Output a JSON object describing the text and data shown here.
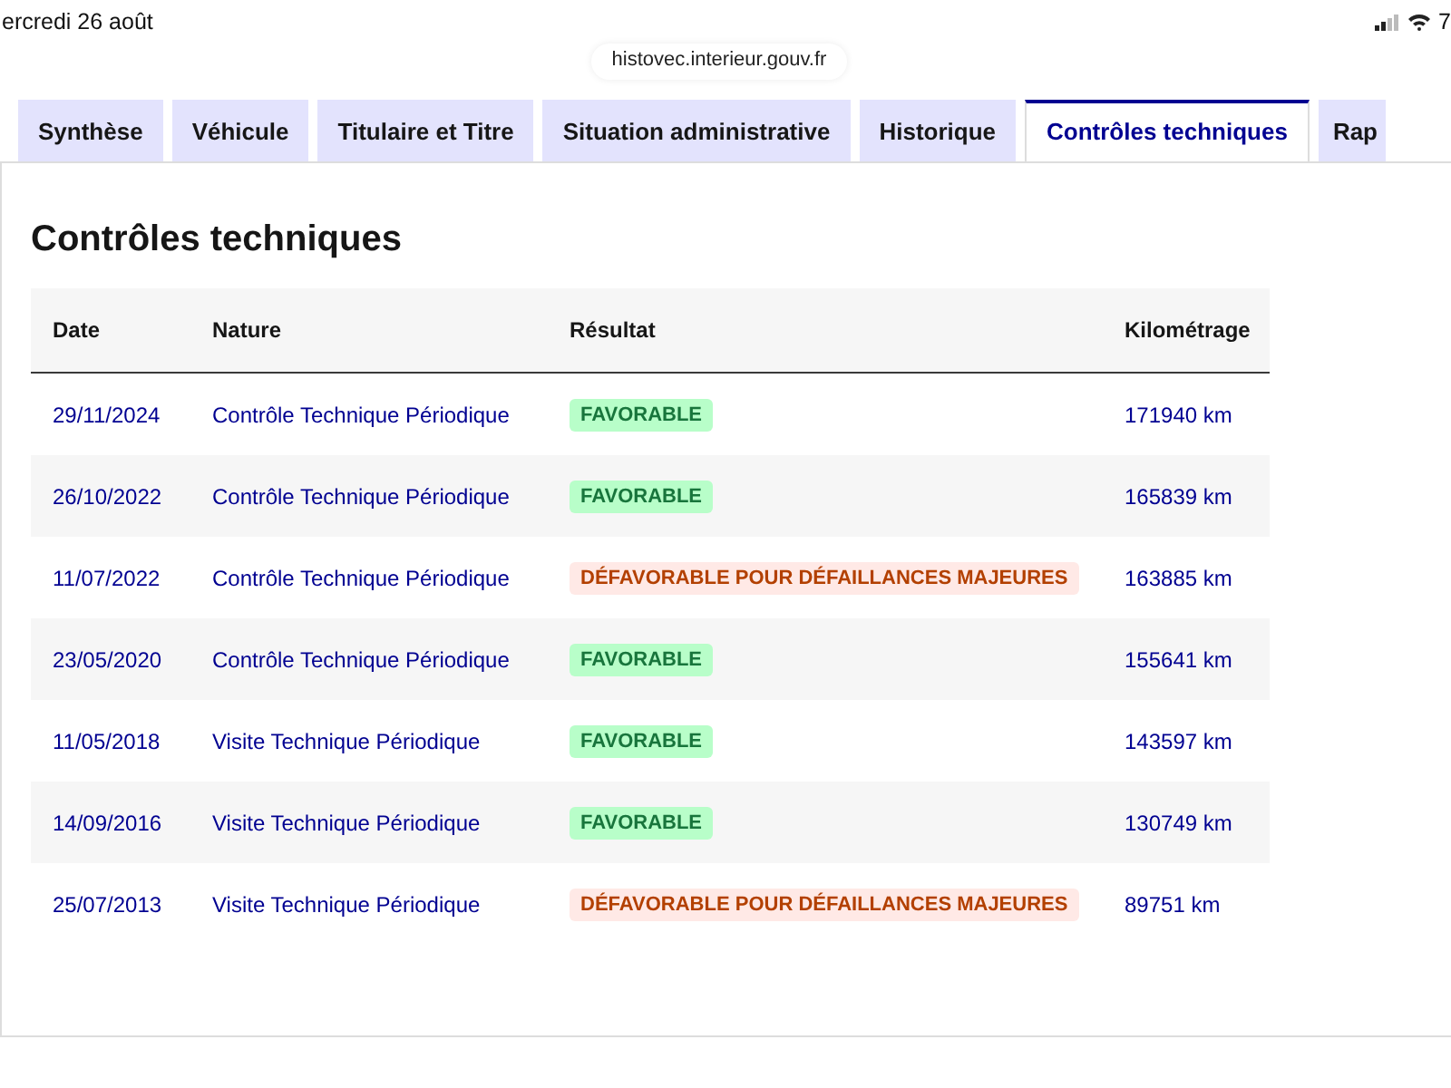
{
  "status_bar": {
    "date": "ercredi 26 août",
    "battery": "7"
  },
  "address_bar": {
    "url": "histovec.interieur.gouv.fr"
  },
  "tabs": [
    {
      "label": "Synthèse",
      "selected": false
    },
    {
      "label": "Véhicule",
      "selected": false
    },
    {
      "label": "Titulaire et Titre",
      "selected": false
    },
    {
      "label": "Situation administrative",
      "selected": false
    },
    {
      "label": "Historique",
      "selected": false
    },
    {
      "label": "Contrôles techniques",
      "selected": true
    },
    {
      "label": "Rap",
      "selected": false
    }
  ],
  "section": {
    "title": "Contrôles techniques"
  },
  "table": {
    "columns": [
      "Date",
      "Nature",
      "Résultat",
      "Kilométrage"
    ],
    "rows": [
      {
        "date": "29/11/2024",
        "nature": "Contrôle Technique Périodique",
        "result": {
          "label": "FAVORABLE",
          "kind": "success"
        },
        "mileage": "171940 km"
      },
      {
        "date": "26/10/2022",
        "nature": "Contrôle Technique Périodique",
        "result": {
          "label": "FAVORABLE",
          "kind": "success"
        },
        "mileage": "165839 km"
      },
      {
        "date": "11/07/2022",
        "nature": "Contrôle Technique Périodique",
        "result": {
          "label": "DÉFAVORABLE POUR DÉFAILLANCES MAJEURES",
          "kind": "error"
        },
        "mileage": "163885 km"
      },
      {
        "date": "23/05/2020",
        "nature": "Contrôle Technique Périodique",
        "result": {
          "label": "FAVORABLE",
          "kind": "success"
        },
        "mileage": "155641 km"
      },
      {
        "date": "11/05/2018",
        "nature": "Visite Technique Périodique",
        "result": {
          "label": "FAVORABLE",
          "kind": "success"
        },
        "mileage": "143597 km"
      },
      {
        "date": "14/09/2016",
        "nature": "Visite Technique Périodique",
        "result": {
          "label": "FAVORABLE",
          "kind": "success"
        },
        "mileage": "130749 km"
      },
      {
        "date": "25/07/2013",
        "nature": "Visite Technique Périodique",
        "result": {
          "label": "DÉFAVORABLE POUR DÉFAILLANCES MAJEURES",
          "kind": "error"
        },
        "mileage": "89751 km"
      }
    ]
  }
}
